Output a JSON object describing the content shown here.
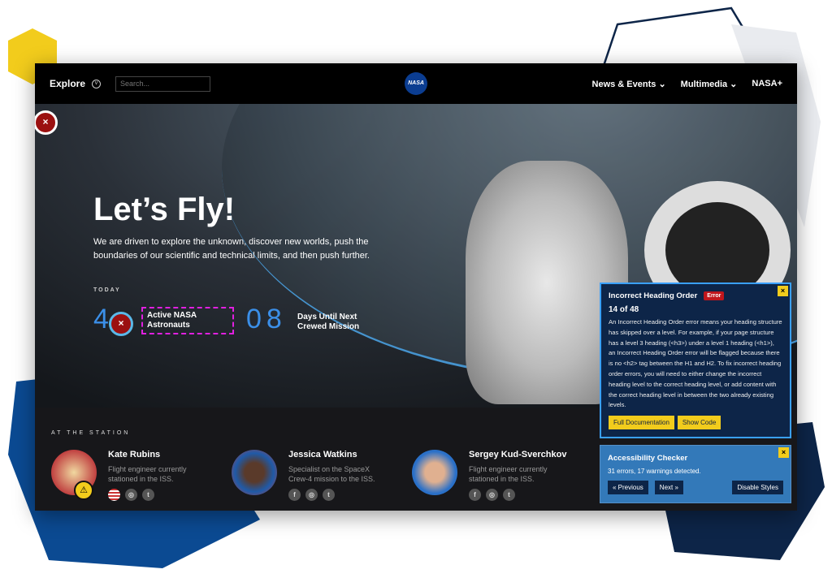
{
  "nav": {
    "explore": "Explore",
    "search_placeholder": "Search...",
    "logo": "NASA",
    "links": [
      "News & Events",
      "Multimedia",
      "NASA+"
    ]
  },
  "hero": {
    "title": "Let’s Fly!",
    "lead": "We are driven to explore the unknown, discover new worlds, push the boundaries of our scientific and technical limits, and then push further.",
    "today": "TODAY",
    "stats": [
      {
        "value": "4",
        "label_line1": "Active NASA",
        "label_line2": "Astronauts"
      },
      {
        "value": "08",
        "label_line1": "Days Until Next",
        "label_line2": "Crewed Mission"
      }
    ]
  },
  "station": {
    "title": "AT THE STATION",
    "people": [
      {
        "name": "Kate Rubins",
        "desc": "Flight engineer currently stationed in the ISS.",
        "socials": [
          "us-flag-icon",
          "instagram-icon",
          "twitter-icon"
        ]
      },
      {
        "name": "Jessica Watkins",
        "desc": "Specialist on the SpaceX Crew-4 mission to the ISS.",
        "socials": [
          "facebook-icon",
          "instagram-icon",
          "twitter-icon"
        ]
      },
      {
        "name": "Sergey Kud-Sverchkov",
        "desc": "Flight engineer currently stationed in the ISS.",
        "socials": [
          "facebook-icon",
          "instagram-icon",
          "twitter-icon"
        ]
      }
    ]
  },
  "issue": {
    "title": "Incorrect Heading Order",
    "badge": "Error",
    "count": "14 of 48",
    "body": "An Incorrect Heading Order error means your heading structure has skipped over a level. For example, if your page structure has a level 3 heading (<h3>) under a level 1 heading (<h1>), an Incorrect Heading Order error will be flagged because there is no <h2> tag between the H1 and H2. To fix incorrect heading order errors, you will need to either change the incorrect heading level to the correct heading level, or add content with the correct heading level in between the two already existing levels.",
    "btn_docs": "Full Documentation",
    "btn_code": "Show Code",
    "close": "×"
  },
  "checker": {
    "title": "Accessibility Checker",
    "summary": "31 errors, 17 warnings detected.",
    "prev": "« Previous",
    "next": "Next »",
    "disable": "Disable Styles",
    "close": "×"
  },
  "colors": {
    "accent": "#3b8fe8",
    "error": "#c0161c",
    "yellow": "#f2cc1c",
    "navy": "#0d2548",
    "panel_blue": "#3379b9"
  }
}
